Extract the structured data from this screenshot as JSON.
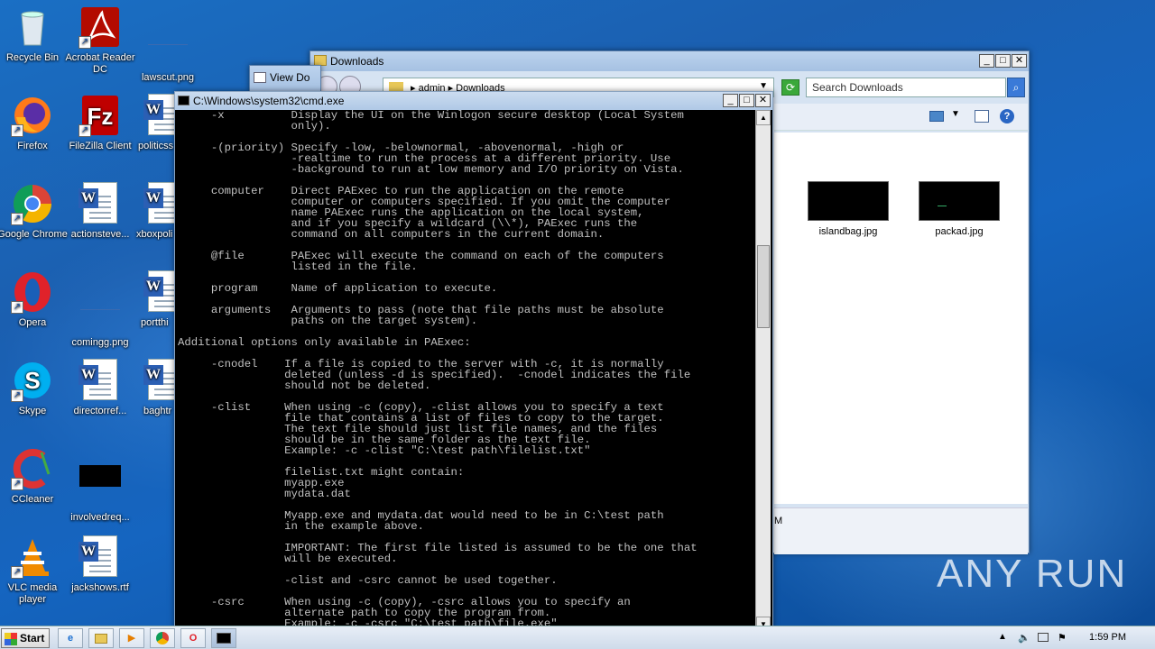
{
  "desktop": {
    "icons_col1": [
      {
        "label": "Recycle Bin",
        "icon": "recycle-bin-icon"
      },
      {
        "label": "Firefox",
        "icon": "firefox-icon"
      },
      {
        "label": "Google Chrome",
        "icon": "chrome-icon"
      },
      {
        "label": "Opera",
        "icon": "opera-icon"
      },
      {
        "label": "Skype",
        "icon": "skype-icon"
      },
      {
        "label": "CCleaner",
        "icon": "ccleaner-icon"
      },
      {
        "label": "VLC media player",
        "icon": "vlc-icon"
      }
    ],
    "icons_col2": [
      {
        "label": "Acrobat Reader DC",
        "icon": "acrobat-icon"
      },
      {
        "label": "FileZilla Client",
        "icon": "filezilla-icon"
      },
      {
        "label": "actionsteve...",
        "icon": "word-doc-icon"
      },
      {
        "label": "comingg.png",
        "icon": "image-icon"
      },
      {
        "label": "directorref...",
        "icon": "word-doc-icon"
      },
      {
        "label": "involvedreq...",
        "icon": "image-icon"
      },
      {
        "label": "jackshows.rtf",
        "icon": "word-doc-icon"
      }
    ],
    "icons_col3": [
      {
        "label": "lawscut.png",
        "icon": "image-icon"
      },
      {
        "label": "politicss",
        "icon": "word-doc-icon"
      },
      {
        "label": "xboxpoli",
        "icon": "word-doc-icon"
      },
      {
        "label": "portthi",
        "icon": "word-doc-icon"
      },
      {
        "label": "baghtr",
        "icon": "word-doc-icon"
      }
    ]
  },
  "explorer": {
    "title": "Downloads",
    "breadcrumb": "▸ admin ▸ Downloads",
    "search_placeholder": "Search Downloads",
    "files": [
      {
        "name": "islandbag.jpg"
      },
      {
        "name": "packad.jpg"
      }
    ],
    "details_fragment": "M"
  },
  "viewdo": {
    "title": "View Do"
  },
  "cmd": {
    "title": "C:\\Windows\\system32\\cmd.exe",
    "lines": [
      "     -x          Display the UI on the Winlogon secure desktop (Local System",
      "                 only).",
      "",
      "     -(priority) Specify -low, -belownormal, -abovenormal, -high or",
      "                 -realtime to run the process at a different priority. Use",
      "                 -background to run at low memory and I/O priority on Vista.",
      "",
      "     computer    Direct PAExec to run the application on the remote",
      "                 computer or computers specified. If you omit the computer",
      "                 name PAExec runs the application on the local system,",
      "                 and if you specify a wildcard (\\\\*), PAExec runs the",
      "                 command on all computers in the current domain.",
      "",
      "     @file       PAExec will execute the command on each of the computers",
      "                 listed in the file.",
      "",
      "     program     Name of application to execute.",
      "",
      "     arguments   Arguments to pass (note that file paths must be absolute",
      "                 paths on the target system).",
      "",
      "Additional options only available in PAExec:",
      "",
      "     -cnodel    If a file is copied to the server with -c, it is normally",
      "                deleted (unless -d is specified).  -cnodel indicates the file",
      "                should not be deleted.",
      "",
      "     -clist     When using -c (copy), -clist allows you to specify a text",
      "                file that contains a list of files to copy to the target.",
      "                The text file should just list file names, and the files",
      "                should be in the same folder as the text file.",
      "                Example: -c -clist \"C:\\test path\\filelist.txt\"",
      "",
      "                filelist.txt might contain:",
      "                myapp.exe",
      "                mydata.dat",
      "",
      "                Myapp.exe and mydata.dat would need to be in C:\\test path",
      "                in the example above.",
      "",
      "                IMPORTANT: The first file listed is assumed to be the one that",
      "                will be executed.",
      "",
      "                -clist and -csrc cannot be used together.",
      "",
      "     -csrc      When using -c (copy), -csrc allows you to specify an",
      "                alternate path to copy the program from.",
      "                Example: -c -csrc \"C:\\test path\\file.exe\""
    ]
  },
  "taskbar": {
    "start_label": "Start",
    "clock": "1:59 PM",
    "items": [
      "ie-icon",
      "explorer-icon",
      "media-player-icon",
      "chrome-icon",
      "opera-icon",
      "cmd-icon"
    ]
  },
  "watermark": "ANY RUN"
}
